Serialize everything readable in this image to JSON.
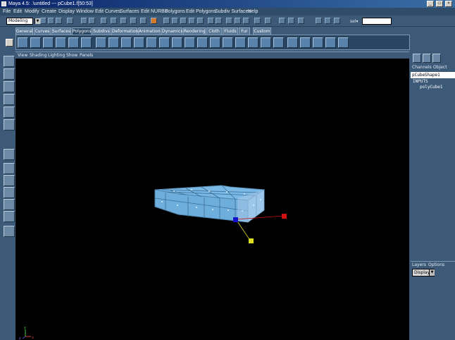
{
  "window": {
    "title": "Maya 4.5: .\\untitled  ---  pCube1.f[50:53]",
    "minimize_glyph": "_",
    "maximize_glyph": "□",
    "close_glyph": "×"
  },
  "menubar": [
    "File",
    "Edit",
    "Modify",
    "Create",
    "Display",
    "Window",
    "Edit Curves",
    "Surfaces",
    "Edit NURBS",
    "Polygons",
    "Edit Polygons",
    "Subdiv Surfaces",
    "Help"
  ],
  "statusline": {
    "mode": "Modeling",
    "dropdown_glyph": "▼",
    "selection_label": "sel▾"
  },
  "shelf": {
    "tabs": [
      "General",
      "Curves",
      "Surfaces",
      "Polygons",
      "Subdivs",
      "Deformation",
      "Animation",
      "Dynamics",
      "Rendering",
      "Cloth",
      "Fluids",
      "Fur",
      "Custom"
    ],
    "active_tab": "Polygons"
  },
  "panel_menu": [
    "View",
    "Shading",
    "Lighting",
    "Show",
    "Panels"
  ],
  "channel_box": {
    "tabs": [
      "Channels",
      "Object"
    ],
    "node": "pCubeShape1",
    "inputs_label": "INPUTS",
    "input_node": "polyCube1"
  },
  "layer_editor": {
    "tabs": [
      "Layers",
      "Options"
    ],
    "display_value": "Display",
    "dropdown_glyph": "▼"
  },
  "viewport": {
    "background": "#000000",
    "mesh_color": "#7ab9e6",
    "selected_face_color": "#aac8e8",
    "axis_x_color": "#cc1111",
    "axis_y_color": "#dddd22",
    "axis_z_color": "#1111cc",
    "view_axis_labels": [
      "x",
      "y",
      "z"
    ]
  },
  "colors": {
    "ui_panel": "#3c5a78",
    "title_bar": "#0a246a"
  }
}
